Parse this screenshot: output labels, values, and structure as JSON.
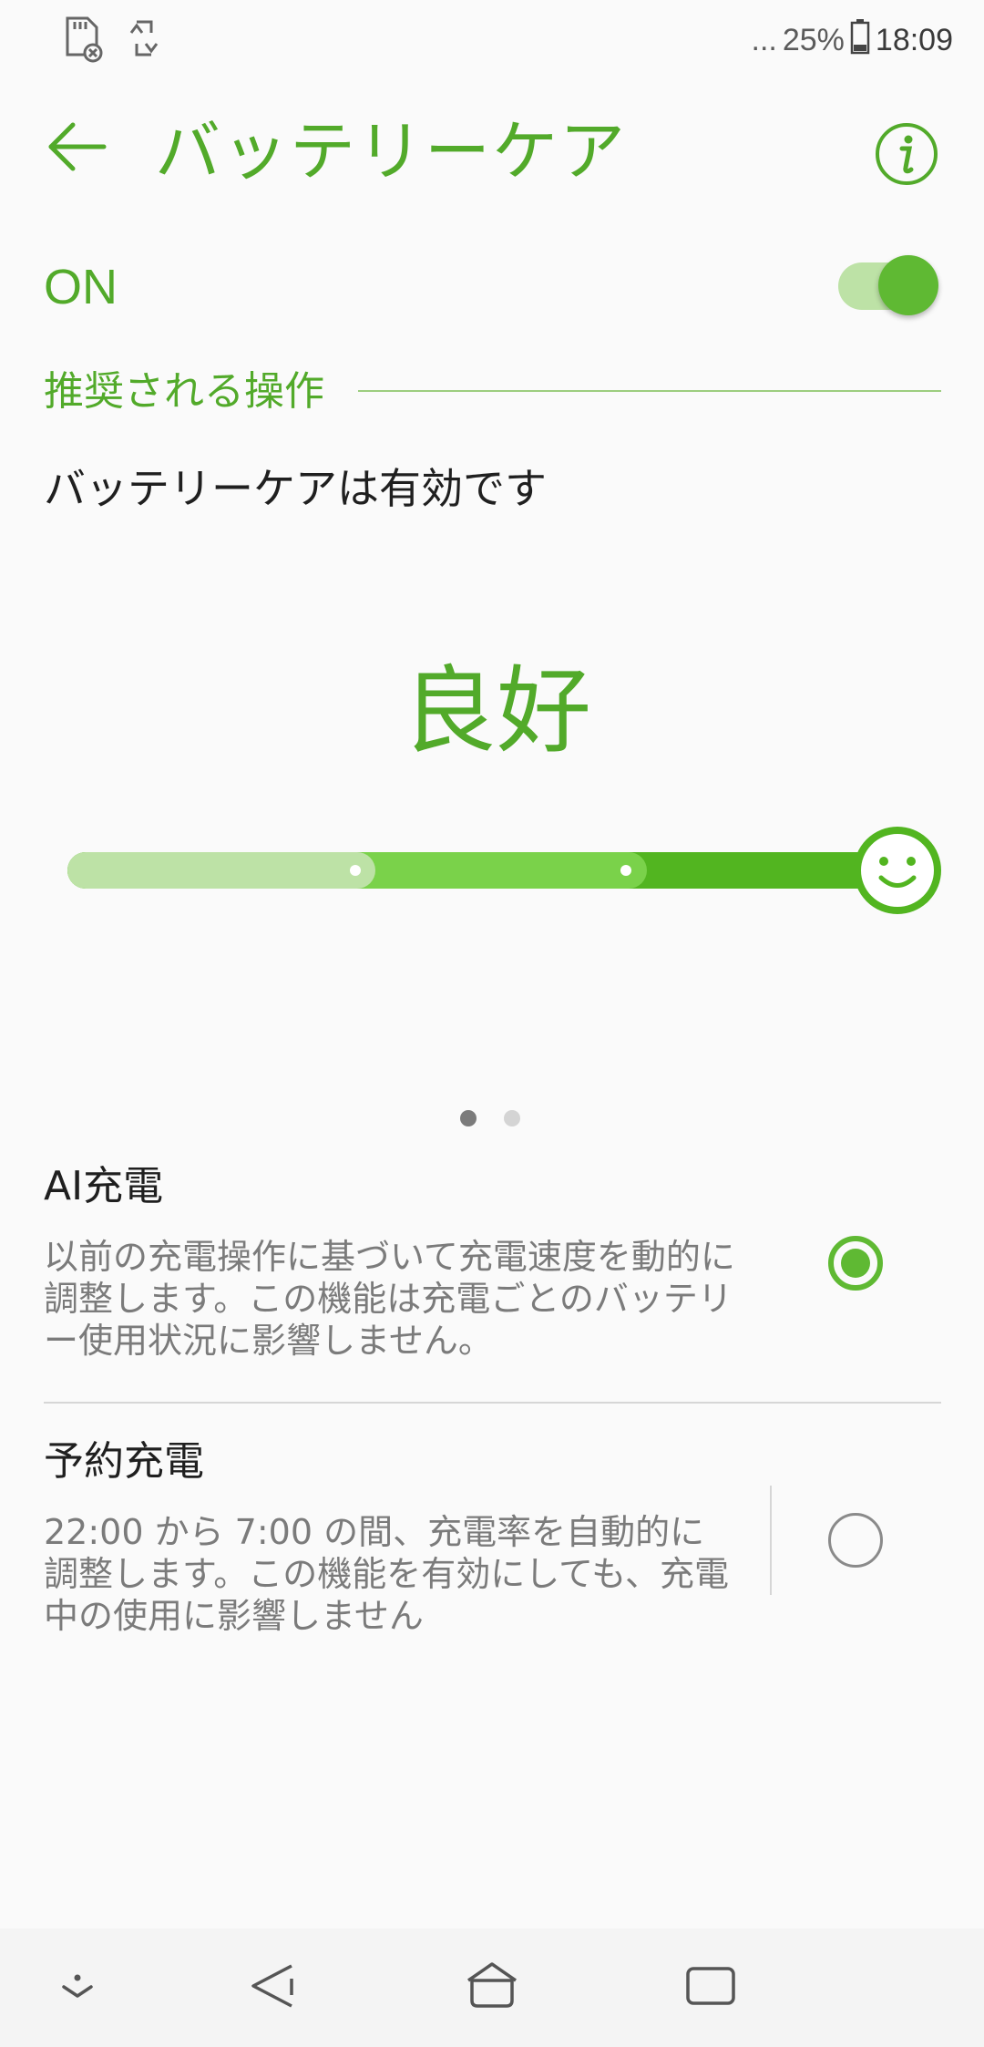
{
  "status_bar": {
    "icons": [
      "sd-card-icon",
      "sync-icon"
    ],
    "more_indicator": "...",
    "battery_percent": "25%",
    "battery_level": 0.25,
    "clock": "18:09"
  },
  "app_bar": {
    "title": "バッテリーケア",
    "back_icon": "back-arrow-icon",
    "info_icon": "info-icon"
  },
  "master_switch": {
    "label": "ON",
    "checked": true
  },
  "section": {
    "header": "推奨される操作"
  },
  "status_message": "バッテリーケアは有効です",
  "battery_health": {
    "level_label": "良好",
    "level": "high",
    "face_icon": "smiley-face-icon"
  },
  "pager": {
    "page_count": 2,
    "current_page": 1
  },
  "options": [
    {
      "title": "AI充電",
      "description": "以前の充電操作に基づいて充電速度を動的に調整します。この機能は充電ごとのバッテリー使用状況に影響しません。",
      "selected": true
    },
    {
      "title": "予約充電",
      "description": "22:00 から 7:00 の間、充電率を自動的に調整します。この機能を有効にしても、充電中の使用に影響しません",
      "selected": false
    }
  ],
  "nav_bar": {
    "icons": [
      "hide-navbar-icon",
      "nav-back-icon",
      "nav-home-icon",
      "nav-recents-icon"
    ]
  },
  "colors": {
    "accent": "#52aa2a",
    "accent_strong": "#5fb933",
    "gauge_light": "#bde2a6",
    "gauge_mid": "#7ad24a",
    "gauge_dark": "#52b520"
  }
}
